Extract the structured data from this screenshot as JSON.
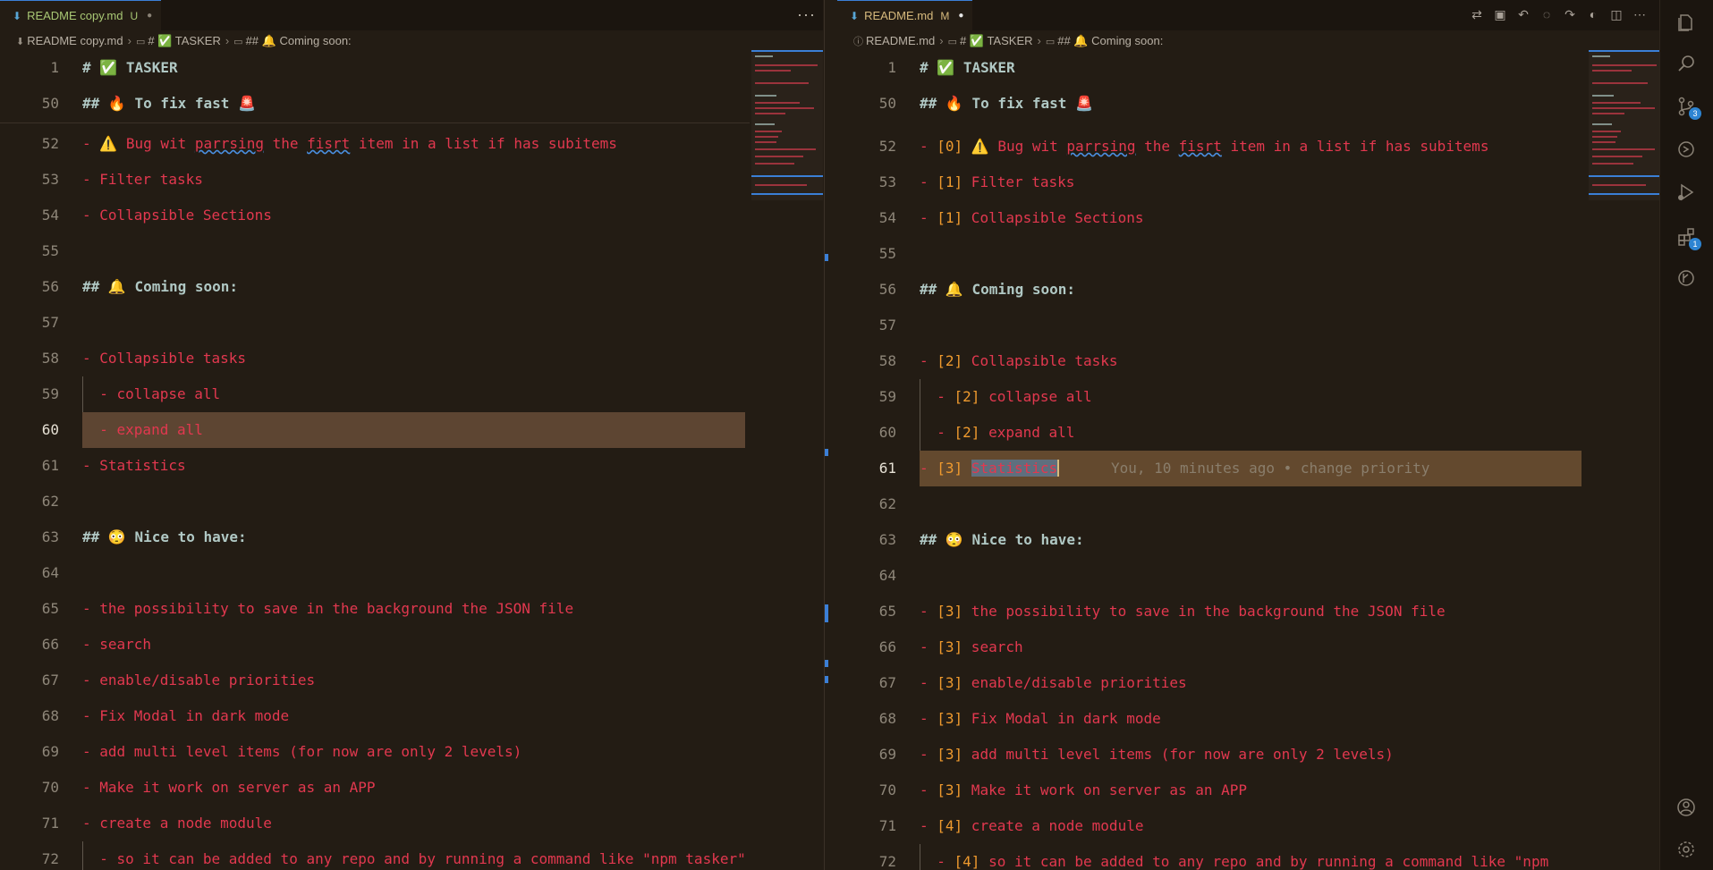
{
  "left": {
    "tab": {
      "title": "README copy.md",
      "state": "U"
    },
    "more_label": "···",
    "breadcrumb": {
      "file": "README copy.md",
      "h1": "# ✅ TASKER",
      "h2": "## 🔔 Coming soon:"
    },
    "sticky": [
      {
        "num": "1",
        "text": "# ✅ TASKER"
      },
      {
        "num": "50",
        "text": "## 🔥 To fix fast 🚨"
      }
    ],
    "lines": [
      {
        "num": "52",
        "text": "- ⚠️ Bug wit parrsing the fisrt item in a list if has subitems"
      },
      {
        "num": "53",
        "text": "- Filter tasks"
      },
      {
        "num": "54",
        "text": "- Collapsible Sections"
      },
      {
        "num": "55",
        "text": ""
      },
      {
        "num": "56",
        "text": "## 🔔 Coming soon:"
      },
      {
        "num": "57",
        "text": ""
      },
      {
        "num": "58",
        "text": "- Collapsible tasks"
      },
      {
        "num": "59",
        "text": "  - collapse all"
      },
      {
        "num": "60",
        "text": "  - expand all"
      },
      {
        "num": "61",
        "text": "- Statistics"
      },
      {
        "num": "62",
        "text": ""
      },
      {
        "num": "63",
        "text": "## 😳 Nice to have:"
      },
      {
        "num": "64",
        "text": ""
      },
      {
        "num": "65",
        "text": "- the possibility to save in the background the JSON file"
      },
      {
        "num": "66",
        "text": "- search"
      },
      {
        "num": "67",
        "text": "- enable/disable priorities"
      },
      {
        "num": "68",
        "text": "- Fix Modal in dark mode"
      },
      {
        "num": "69",
        "text": "- add multi level items (for now are only 2 levels)"
      },
      {
        "num": "70",
        "text": "- Make it work on server as an APP"
      },
      {
        "num": "71",
        "text": "- create a node module"
      },
      {
        "num": "72",
        "text": "  - so it can be added to any repo and by running a command like \"npm tasker\""
      }
    ]
  },
  "right": {
    "tab": {
      "title": "README.md",
      "state": "M"
    },
    "breadcrumb": {
      "file": "README.md",
      "h1": "# ✅ TASKER",
      "h2": "## 🔔 Coming soon:"
    },
    "sticky": [
      {
        "num": "1",
        "text": "# ✅ TASKER"
      },
      {
        "num": "50",
        "text": "## 🔥 To fix fast 🚨"
      }
    ],
    "lines": [
      {
        "num": "52",
        "prefix": "- ",
        "bracket": "[0]",
        "text": " ⚠️ Bug wit parrsing the fisrt item in a list if has subitems"
      },
      {
        "num": "53",
        "prefix": "- ",
        "bracket": "[1]",
        "text": " Filter tasks"
      },
      {
        "num": "54",
        "prefix": "- ",
        "bracket": "[1]",
        "text": " Collapsible Sections"
      },
      {
        "num": "55",
        "prefix": "",
        "bracket": "",
        "text": ""
      },
      {
        "num": "56",
        "prefix": "",
        "bracket": "",
        "text": "## 🔔 Coming soon:"
      },
      {
        "num": "57",
        "prefix": "",
        "bracket": "",
        "text": ""
      },
      {
        "num": "58",
        "prefix": "- ",
        "bracket": "[2]",
        "text": " Collapsible tasks"
      },
      {
        "num": "59",
        "prefix": "  - ",
        "bracket": "[2]",
        "text": " collapse all"
      },
      {
        "num": "60",
        "prefix": "  - ",
        "bracket": "[2]",
        "text": " expand all"
      },
      {
        "num": "61",
        "prefix": "- ",
        "bracket": "[3]",
        "text": " Statistics"
      },
      {
        "num": "62",
        "prefix": "",
        "bracket": "",
        "text": ""
      },
      {
        "num": "63",
        "prefix": "",
        "bracket": "",
        "text": "## 😳 Nice to have:"
      },
      {
        "num": "64",
        "prefix": "",
        "bracket": "",
        "text": ""
      },
      {
        "num": "65",
        "prefix": "- ",
        "bracket": "[3]",
        "text": " the possibility to save in the background the JSON file"
      },
      {
        "num": "66",
        "prefix": "- ",
        "bracket": "[3]",
        "text": " search"
      },
      {
        "num": "67",
        "prefix": "- ",
        "bracket": "[3]",
        "text": " enable/disable priorities"
      },
      {
        "num": "68",
        "prefix": "- ",
        "bracket": "[3]",
        "text": " Fix Modal in dark mode"
      },
      {
        "num": "69",
        "prefix": "- ",
        "bracket": "[3]",
        "text": " add multi level items (for now are only 2 levels)"
      },
      {
        "num": "70",
        "prefix": "- ",
        "bracket": "[3]",
        "text": " Make it work on server as an APP"
      },
      {
        "num": "71",
        "prefix": "- ",
        "bracket": "[4]",
        "text": " create a node module"
      },
      {
        "num": "72",
        "prefix": "  - ",
        "bracket": "[4]",
        "text": " so it can be added to any repo and by running a command like \"npm"
      }
    ],
    "blame": "You, 10 minutes ago • change priority"
  },
  "activity_bar": {
    "items": [
      {
        "name": "explorer-icon"
      },
      {
        "name": "search-icon"
      },
      {
        "name": "source-control-icon",
        "badge": "3"
      },
      {
        "name": "remote-explorer-icon"
      },
      {
        "name": "run-debug-icon"
      },
      {
        "name": "extensions-icon",
        "badge": "1"
      },
      {
        "name": "git-graph-icon"
      }
    ]
  },
  "colors": {
    "background": "#231c14",
    "text_red": "#e2384f",
    "bracket_orange": "#ef9a2e",
    "heading": "#b0c8c4",
    "accent_blue": "#3b7fd6",
    "highlight": "#5d4532"
  }
}
